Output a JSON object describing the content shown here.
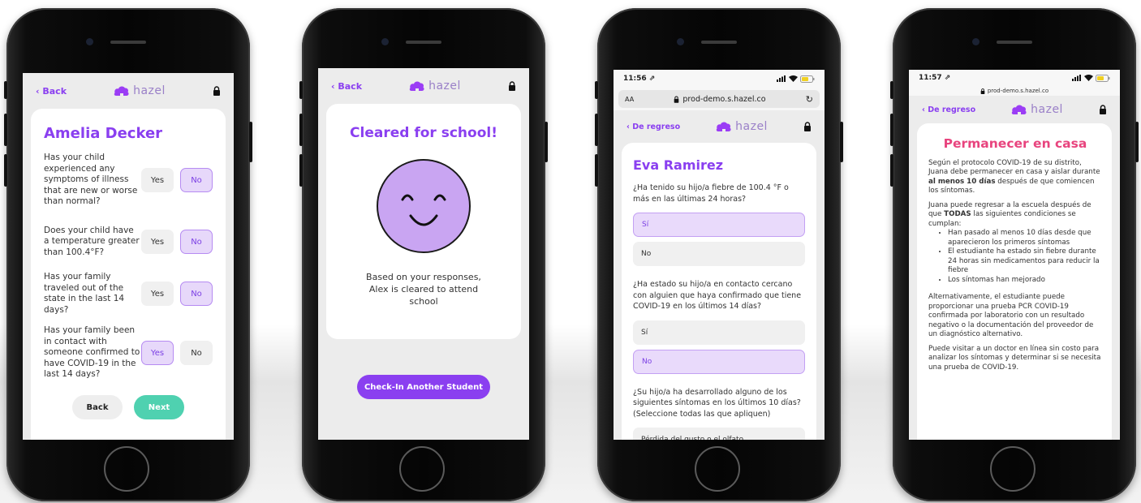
{
  "colors": {
    "accent": "#8a3ff0",
    "selected_bg": "#e7d8fa",
    "success": "#4fd1b0",
    "alert": "#e8447e",
    "face": "#c9a5f2"
  },
  "phone1": {
    "nav": {
      "back": "‹ Back",
      "brand": "hazel"
    },
    "student_name": "Amelia Decker",
    "questions": [
      {
        "text": "Has your child experienced any symptoms of illness that are new or worse than normal?",
        "yes": "Yes",
        "no": "No",
        "selected": "no"
      },
      {
        "text": "Does your child have a temperature greater than 100.4°F?",
        "yes": "Yes",
        "no": "No",
        "selected": "no"
      },
      {
        "text": "Has your family traveled out of the state in the last 14 days?",
        "yes": "Yes",
        "no": "No",
        "selected": "no"
      },
      {
        "text": "Has your family been in contact with someone confirmed to have COVID-19 in the last 14 days?",
        "yes": "Yes",
        "no": "No",
        "selected": "yes"
      }
    ],
    "back_button": "Back",
    "next_button": "Next"
  },
  "phone2": {
    "nav": {
      "back": "‹ Back",
      "brand": "hazel"
    },
    "title": "Cleared for school!",
    "message": "Based on your responses, Alex is cleared to attend school",
    "button": "Check-In Another Student"
  },
  "phone3": {
    "status": {
      "time": "11:56 ⇗"
    },
    "browser": {
      "aa": "AA",
      "url": "prod-demo.s.hazel.co"
    },
    "nav": {
      "back": "‹ De regreso",
      "brand": "hazel"
    },
    "student_name": "Eva Ramirez",
    "questions": [
      {
        "text": "¿Ha tenido su hijo/a fiebre de 100.4 °F o más en las últimas 24 horas?",
        "options": [
          "Sí",
          "No"
        ],
        "selected": 0
      },
      {
        "text": "¿Ha estado su hijo/a en contacto cercano con alguien que haya confirmado que tiene COVID-19 en los últimos 14 días?",
        "options": [
          "Sí",
          "No"
        ],
        "selected": 1
      },
      {
        "text": "¿Su hijo/a ha desarrollado alguno de los siguientes síntomas en los últimos 10 días? (Seleccione todas las que apliquen)",
        "options": [
          "Pérdida del gusto o el olfato"
        ]
      }
    ]
  },
  "phone4": {
    "status": {
      "time": "11:57 ⇗"
    },
    "browser": {
      "url": "prod-demo.s.hazel.co"
    },
    "nav": {
      "back": "‹ De regreso",
      "brand": "hazel"
    },
    "title": "Permanecer en casa",
    "p1_a": "Según el protocolo COVID-19 de su distrito, Juana debe permanecer en casa y aislar durante ",
    "p1_b": "al menos 10 días",
    "p1_c": " después de que comiencen los síntomas.",
    "p2_a": "Juana puede regresar a la escuela después de que ",
    "p2_b": "TODAS",
    "p2_c": " las siguientes condiciones se cumplan:",
    "bullets": [
      "Han pasado al menos 10 días desde que aparecieron los primeros síntomas",
      "El estudiante ha estado sin fiebre durante 24 horas sin medicamentos para reducir la fiebre",
      "Los síntomas han mejorado"
    ],
    "p3": "Alternativamente, el estudiante puede proporcionar una prueba PCR COVID-19 confirmada por laboratorio con un resultado negativo o la documentación del proveedor de un diagnóstico alternativo.",
    "p4": "Puede visitar a un doctor en línea sin costo para analizar los síntomas y determinar si se necesita una prueba de COVID-19."
  }
}
